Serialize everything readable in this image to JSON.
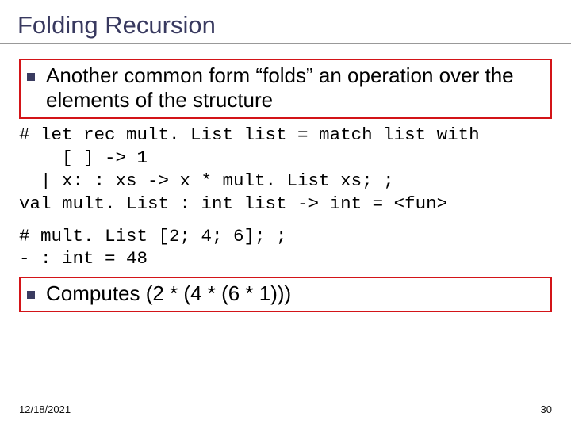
{
  "title": "Folding Recursion",
  "bullet1": "Another common form “folds” an operation over the elements of the structure",
  "code1": "# let rec mult. List list = match list with\n    [ ] -> 1\n  | x: : xs -> x * mult. List xs; ;\nval mult. List : int list -> int = <fun>",
  "code2": "# mult. List [2; 4; 6]; ;\n- : int = 48",
  "bullet2": "Computes (2 * (4 * (6 * 1)))",
  "footer": {
    "date": "12/18/2021",
    "page": "30"
  }
}
